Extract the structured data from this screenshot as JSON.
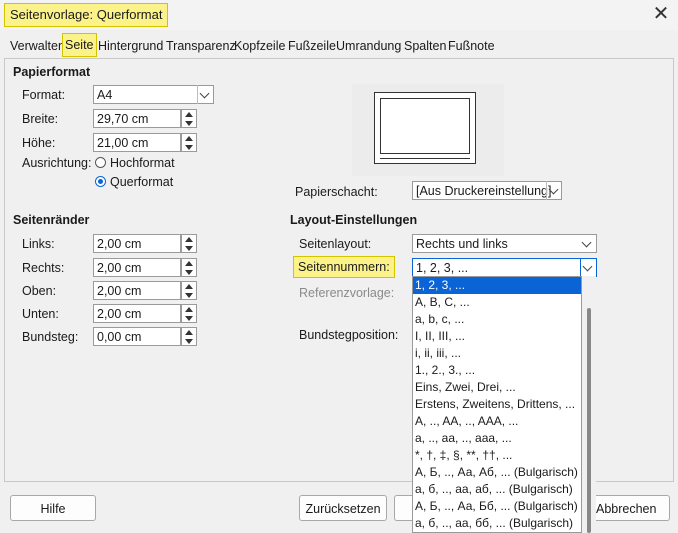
{
  "window": {
    "title": "Seitenvorlage: Querformat",
    "close_glyph": "✕"
  },
  "tabs": [
    "Verwalten",
    "Seite",
    "Hintergrund",
    "Transparenz",
    "Kopfzeile",
    "Fußzeile",
    "Umrandung",
    "Spalten",
    "Fußnote"
  ],
  "active_tab": "Seite",
  "paper": {
    "heading": "Papierformat",
    "format_label": "Format:",
    "format_value": "A4",
    "width_label": "Breite:",
    "width_value": "29,70 cm",
    "height_label": "Höhe:",
    "height_value": "21,00 cm",
    "orientation_label": "Ausrichtung:",
    "portrait_label": "Hochformat",
    "landscape_label": "Querformat",
    "tray_label": "Papierschacht:",
    "tray_value": "[Aus Druckereinstellung]"
  },
  "margins": {
    "heading": "Seitenränder",
    "left_label": "Links:",
    "left_value": "2,00 cm",
    "right_label": "Rechts:",
    "right_value": "2,00 cm",
    "top_label": "Oben:",
    "top_value": "2,00 cm",
    "bottom_label": "Unten:",
    "bottom_value": "2,00 cm",
    "gutter_label": "Bundsteg:",
    "gutter_value": "0,00 cm"
  },
  "layout": {
    "heading": "Layout-Einstellungen",
    "page_layout_label": "Seitenlayout:",
    "page_layout_value": "Rechts und links",
    "page_numbers_label": "Seitennummern:",
    "page_numbers_value": "1, 2, 3, ...",
    "reference_label": "Referenzvorlage:",
    "gutter_pos_label": "Bundstegposition:",
    "page_numbers_options": [
      "1, 2, 3, ...",
      "A, B, C, ...",
      "a, b, c, ...",
      "I, II, III, ...",
      "i, ii, iii, ...",
      "1., 2., 3., ...",
      "Eins, Zwei, Drei, ...",
      "Erstens, Zweitens, Drittens, ...",
      "A, .., AA, .., AAA, ...",
      "a, .., aa, .., aaa, ...",
      "*, †, ‡, §, **, ††, ...",
      "А, Б, .., Аа, Аб, ... (Bulgarisch)",
      "а, б, .., аа, аб, ... (Bulgarisch)",
      "А, Б, .., Аа, Бб, ... (Bulgarisch)",
      "а, б, .., аа, бб, ... (Bulgarisch)"
    ]
  },
  "buttons": {
    "help": "Hilfe",
    "reset": "Zurücksetzen",
    "cancel": "Abbrechen"
  },
  "colors": {
    "highlight": "#fbf38a",
    "selection": "#0a64d6"
  }
}
